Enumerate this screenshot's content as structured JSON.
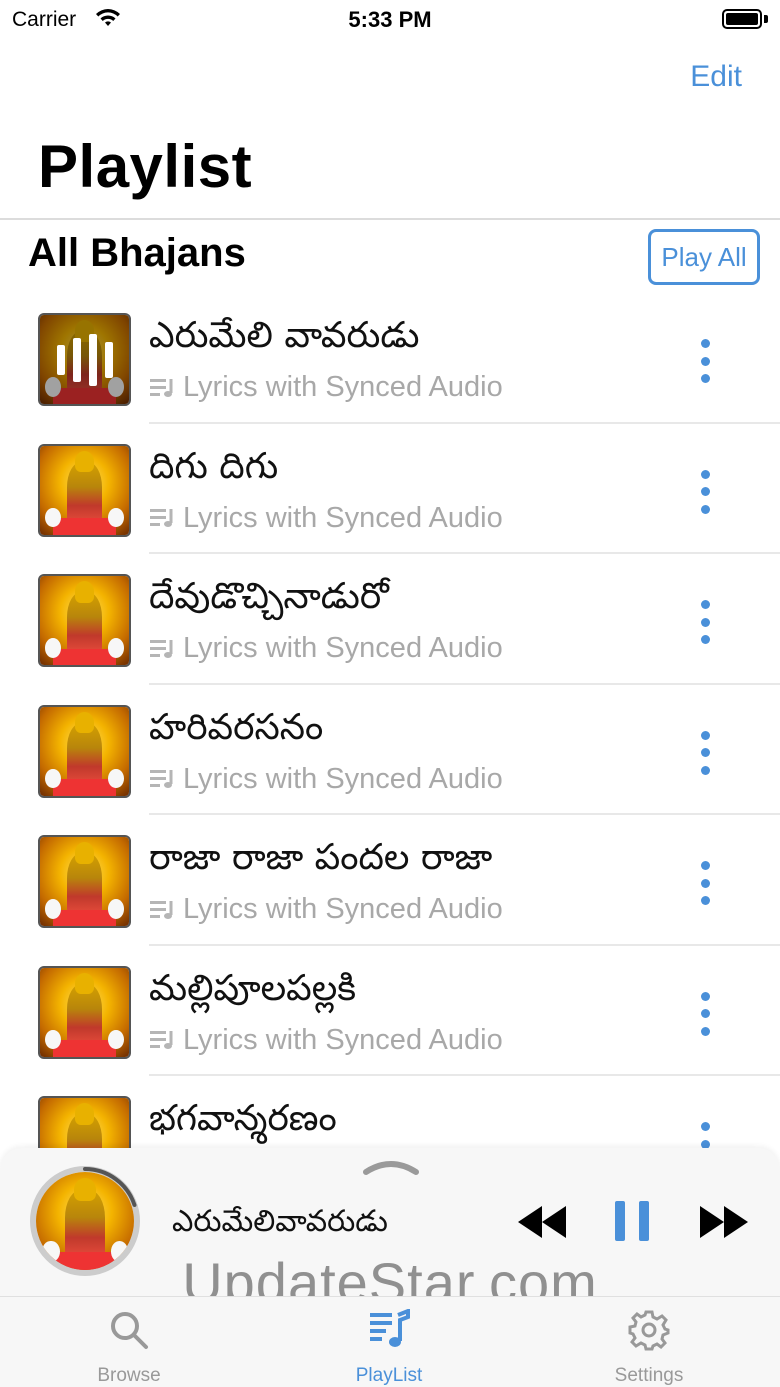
{
  "status_bar": {
    "carrier": "Carrier",
    "time": "5:33 PM"
  },
  "header": {
    "edit_label": "Edit",
    "title": "Playlist"
  },
  "section": {
    "title": "All Bhajans",
    "play_all_label": "Play All"
  },
  "songs": [
    {
      "title": "ఎరుమేలి వావరుడు",
      "subtitle": "Lyrics with Synced Audio",
      "playing": true
    },
    {
      "title": "దిగు దిగు",
      "subtitle": "Lyrics with Synced Audio",
      "playing": false
    },
    {
      "title": "దేవుడొచ్చినాడురో",
      "subtitle": "Lyrics with Synced Audio",
      "playing": false
    },
    {
      "title": "హరివరసనం",
      "subtitle": "Lyrics with Synced Audio",
      "playing": false
    },
    {
      "title": "రాజా రాజా పందల రాజా",
      "subtitle": "Lyrics with Synced Audio",
      "playing": false
    },
    {
      "title": "మల్లిపూలపల్లకి",
      "subtitle": "Lyrics with Synced Audio",
      "playing": false
    },
    {
      "title": "భగవాన్శరణం",
      "subtitle": "Lyrics with Synced Audio",
      "playing": false
    }
  ],
  "player": {
    "now_playing": "ఎరుమేలివావరుడు",
    "progress": 0.2
  },
  "watermark": "UpdateStar.com",
  "tabs": [
    {
      "label": "Browse",
      "icon": "search-icon",
      "active": false
    },
    {
      "label": "PlayList",
      "icon": "playlist-icon",
      "active": true
    },
    {
      "label": "Settings",
      "icon": "gear-icon",
      "active": false
    }
  ],
  "colors": {
    "accent": "#4a90d9",
    "subtitle": "#a8a8a8"
  }
}
